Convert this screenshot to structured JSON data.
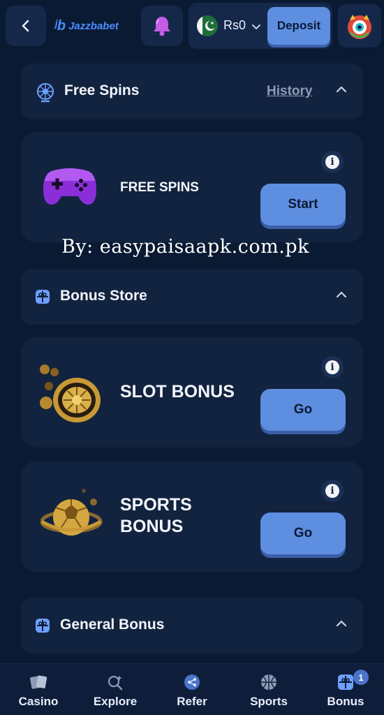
{
  "header": {
    "logo_text": "Jazzbabet",
    "balance": "Rs0",
    "deposit_label": "Deposit"
  },
  "free_spins_section": {
    "title": "Free Spins",
    "history_label": "History"
  },
  "free_spins_card": {
    "title": "FREE SPINS",
    "button_label": "Start"
  },
  "watermark": "By: easypaisaapk.com.pk",
  "bonus_store_section": {
    "title": "Bonus Store"
  },
  "slot_bonus_card": {
    "title": "SLOT BONUS",
    "button_label": "Go"
  },
  "sports_bonus_card": {
    "title_line1": "SPORTS",
    "title_line2": "BONUS",
    "button_label": "Go"
  },
  "general_bonus_section": {
    "title": "General Bonus"
  },
  "bottom_nav": {
    "items": [
      {
        "label": "Casino",
        "icon": "cards-icon"
      },
      {
        "label": "Explore",
        "icon": "explore-icon"
      },
      {
        "label": "Refer",
        "icon": "share-icon"
      },
      {
        "label": "Sports",
        "icon": "basketball-icon"
      },
      {
        "label": "Bonus",
        "icon": "gift-icon",
        "badge": "1"
      }
    ]
  },
  "colors": {
    "background": "#0b1a33",
    "card": "#12233f",
    "accent": "#5e8ee0",
    "logo": "#4a8cff"
  }
}
